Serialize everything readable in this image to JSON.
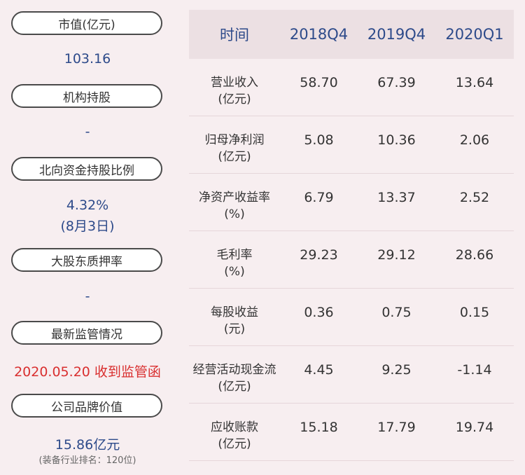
{
  "left": {
    "market_cap_label": "市值(亿元)",
    "market_cap_value": "103.16",
    "institution_label": "机构持股",
    "institution_value": "-",
    "northbound_label": "北向资金持股比例",
    "northbound_value": "4.32%",
    "northbound_date": "(8月3日)",
    "pledge_label": "大股东质押率",
    "pledge_value": "-",
    "regulation_label": "最新监管情况",
    "regulation_value": "2020.05.20 收到监管函",
    "brand_label": "公司品牌价值",
    "brand_value": "15.86亿元",
    "brand_rank": "(装备行业排名：120位)"
  },
  "table": {
    "headers": [
      "时间",
      "2018Q4",
      "2019Q4",
      "2020Q1"
    ],
    "rows": [
      {
        "name": "营业收入",
        "unit": "(亿元)",
        "values": [
          "58.70",
          "67.39",
          "13.64"
        ]
      },
      {
        "name": "归母净利润",
        "unit": "(亿元)",
        "values": [
          "5.08",
          "10.36",
          "2.06"
        ]
      },
      {
        "name": "净资产收益率",
        "unit": "(%)",
        "values": [
          "6.79",
          "13.37",
          "2.52"
        ]
      },
      {
        "name": "毛利率",
        "unit": "(%)",
        "values": [
          "29.23",
          "29.12",
          "28.66"
        ]
      },
      {
        "name": "每股收益",
        "unit": "(元)",
        "values": [
          "0.36",
          "0.75",
          "0.15"
        ]
      },
      {
        "name": "经营活动现金流",
        "unit": "(亿元)",
        "values": [
          "4.45",
          "9.25",
          "-1.14"
        ]
      },
      {
        "name": "应收账款",
        "unit": "(亿元)",
        "values": [
          "15.18",
          "17.79",
          "19.74"
        ]
      }
    ]
  },
  "colors": {
    "background": "#f7eef0",
    "header_bg": "#ece0e3",
    "accent_blue": "#2d4a8a",
    "alert_red": "#d92f2f"
  }
}
